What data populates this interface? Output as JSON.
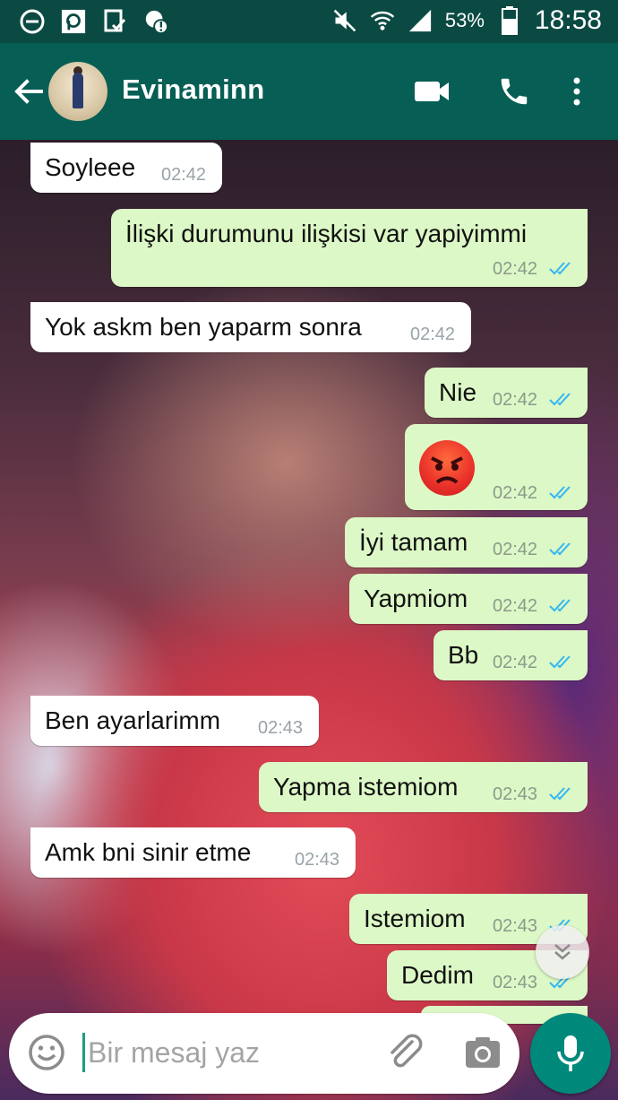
{
  "status_bar": {
    "battery_pct": "53%",
    "time": "18:58"
  },
  "header": {
    "contact_name": "Evinaminn"
  },
  "messages": [
    {
      "dir": "in",
      "text": "Soyleee",
      "time": "02:42"
    },
    {
      "dir": "out",
      "text": "İlişki durumunu ilişkisi var yapiyimmi",
      "time": "02:42"
    },
    {
      "dir": "in",
      "text": "Yok askm ben yaparm sonra",
      "time": "02:42"
    },
    {
      "dir": "out",
      "text": "Nie",
      "time": "02:42"
    },
    {
      "dir": "out",
      "text": "",
      "emoji": "angry-face",
      "time": "02:42"
    },
    {
      "dir": "out",
      "text": "İyi tamam",
      "time": "02:42"
    },
    {
      "dir": "out",
      "text": "Yapmiom",
      "time": "02:42"
    },
    {
      "dir": "out",
      "text": "Bb",
      "time": "02:42"
    },
    {
      "dir": "in",
      "text": "Ben ayarlarimm",
      "time": "02:43"
    },
    {
      "dir": "out",
      "text": "Yapma istemiom",
      "time": "02:43"
    },
    {
      "dir": "in",
      "text": "Amk bni sinir etme",
      "time": "02:43"
    },
    {
      "dir": "out",
      "text": "Istemiom",
      "time": "02:43"
    },
    {
      "dir": "out",
      "text": "Dedim",
      "time": "02:43"
    }
  ],
  "composer": {
    "placeholder": "Bir mesaj yaz"
  },
  "colors": {
    "header": "#075e54",
    "status_bar": "#0b4a43",
    "outgoing_bubble": "#dcf8c6",
    "incoming_bubble": "#ffffff",
    "read_ticks": "#34b7f1",
    "mic_button": "#00897b"
  },
  "icons": [
    "back-arrow-icon",
    "video-call-icon",
    "phone-icon",
    "more-options-icon",
    "emoji-icon",
    "attach-icon",
    "camera-icon",
    "mic-icon",
    "scroll-down-icon"
  ]
}
